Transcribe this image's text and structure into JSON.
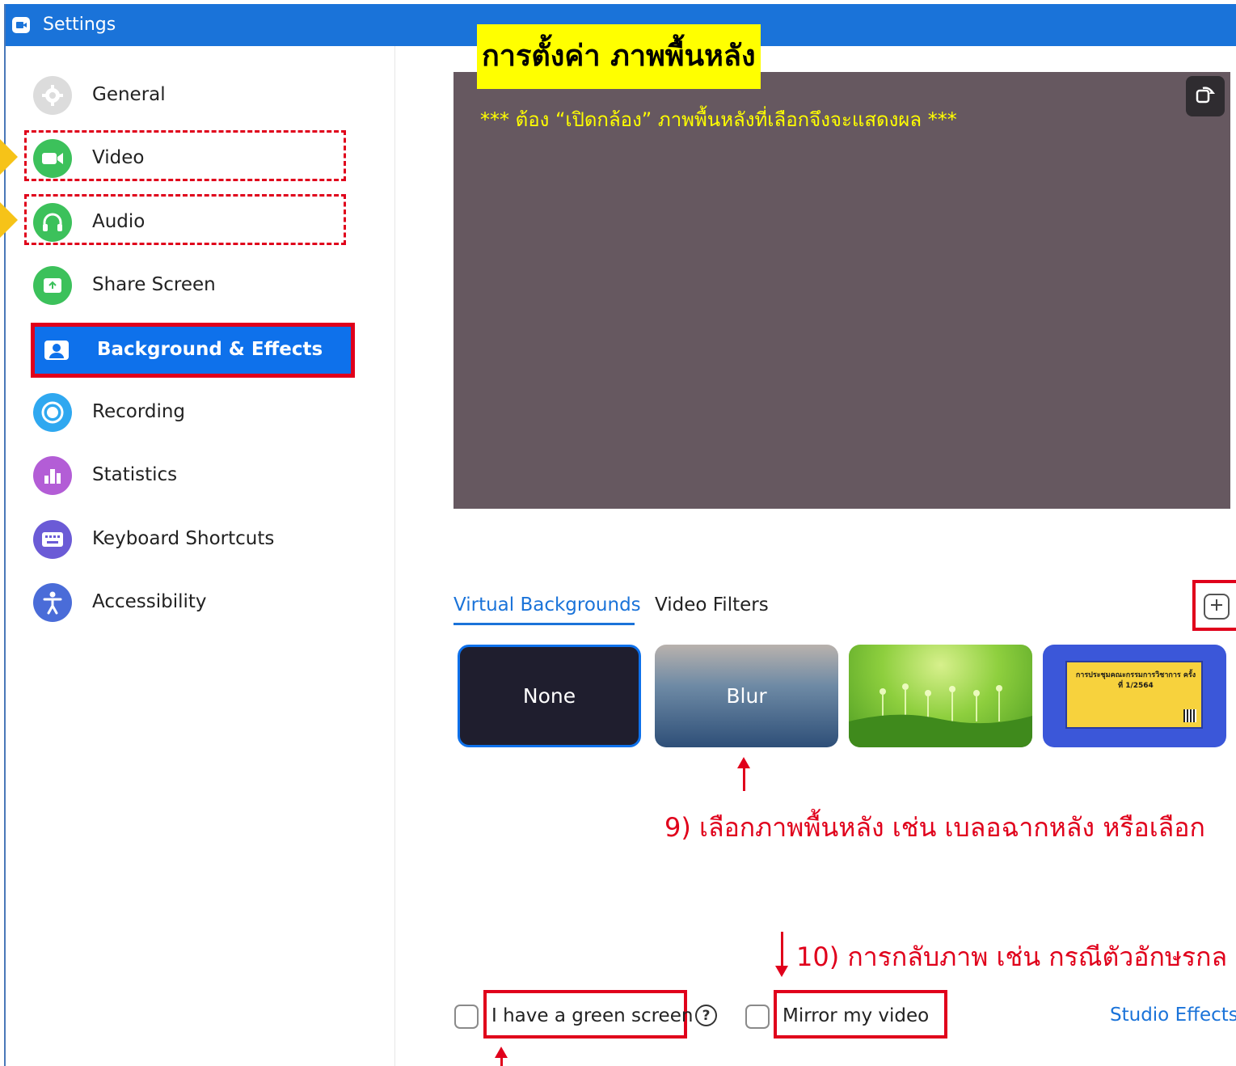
{
  "window": {
    "title": "Settings"
  },
  "header_banner": "การตั้งค่า ภาพพื้นหลัง",
  "preview": {
    "note": "*** ต้อง “เปิดกล้อง” ภาพพื้นหลังที่เลือกจึงจะแสดงผล ***"
  },
  "sidebar": {
    "items": [
      {
        "label": "General",
        "icon": "gear-icon",
        "color": "#d9d9d9"
      },
      {
        "label": "Video",
        "icon": "video-camera-icon",
        "color": "#3cc15b"
      },
      {
        "label": "Audio",
        "icon": "headphones-icon",
        "color": "#3cc15b"
      },
      {
        "label": "Share Screen",
        "icon": "share-screen-icon",
        "color": "#3cc15b"
      },
      {
        "label": "Background & Effects",
        "icon": "person-portrait-icon",
        "active": true
      },
      {
        "label": "Recording",
        "icon": "record-icon",
        "color": "#2fa8f0"
      },
      {
        "label": "Statistics",
        "icon": "bar-chart-icon",
        "color": "#b35dd6"
      },
      {
        "label": "Keyboard Shortcuts",
        "icon": "keyboard-icon",
        "color": "#6b5bd6"
      },
      {
        "label": "Accessibility",
        "icon": "accessibility-icon",
        "color": "#4a6cd8"
      }
    ]
  },
  "tabs": {
    "virtual": "Virtual Backgrounds",
    "filters": "Video Filters"
  },
  "thumbnails": {
    "none": "None",
    "blur": "Blur",
    "poster_title": "การประชุมคณะกรรมการวิชาการ ครั้งที่ 1/2564"
  },
  "notes": {
    "step9": "9) เลือกภาพพื้นหลัง เช่น เบลอฉากหลัง หรือเลือก",
    "step10": "10) การกลับภาพ เช่น กรณีตัวอักษรกล"
  },
  "options": {
    "green_screen": "I have a green screen",
    "help": "?",
    "mirror": "Mirror my video",
    "studio_effects": "Studio Effects"
  }
}
